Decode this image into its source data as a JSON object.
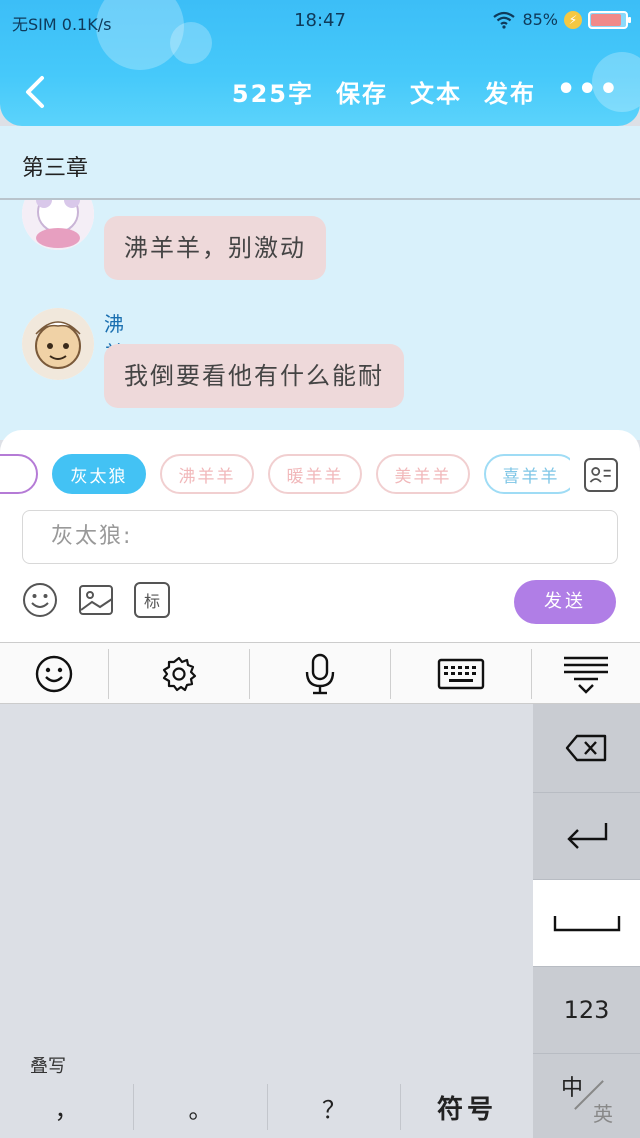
{
  "status_bar": {
    "carrier": "无SIM 0.1K/s",
    "time": "18:47",
    "battery": "85%"
  },
  "header": {
    "word_count": "525字",
    "save": "保存",
    "text": "文本",
    "publish": "发布",
    "more": "•••"
  },
  "chapter": {
    "title": "第三章"
  },
  "messages": [
    {
      "sender": "",
      "text": "沸羊羊，别激动"
    },
    {
      "sender": "沸羊羊",
      "text": "我倒要看他有什么能耐"
    }
  ],
  "composer": {
    "characters": [
      "灰太狼",
      "沸羊羊",
      "暖羊羊",
      "美羊羊",
      "喜羊羊"
    ],
    "selected": "灰太狼",
    "input_value": "灰太狼:",
    "tag_label": "标",
    "send_label": "发送"
  },
  "keyboard": {
    "overwrite_label": "叠写",
    "comma": "，",
    "period": "。",
    "question": "？",
    "symbols": "符号",
    "numbers": "123",
    "lang_zh": "中",
    "lang_en": "英"
  },
  "colors": {
    "header": "#46c9fa",
    "chat_bg": "#d9f1fb",
    "bubble": "#eed9da",
    "chip_active": "#43c2f4",
    "send": "#b07ee6"
  }
}
